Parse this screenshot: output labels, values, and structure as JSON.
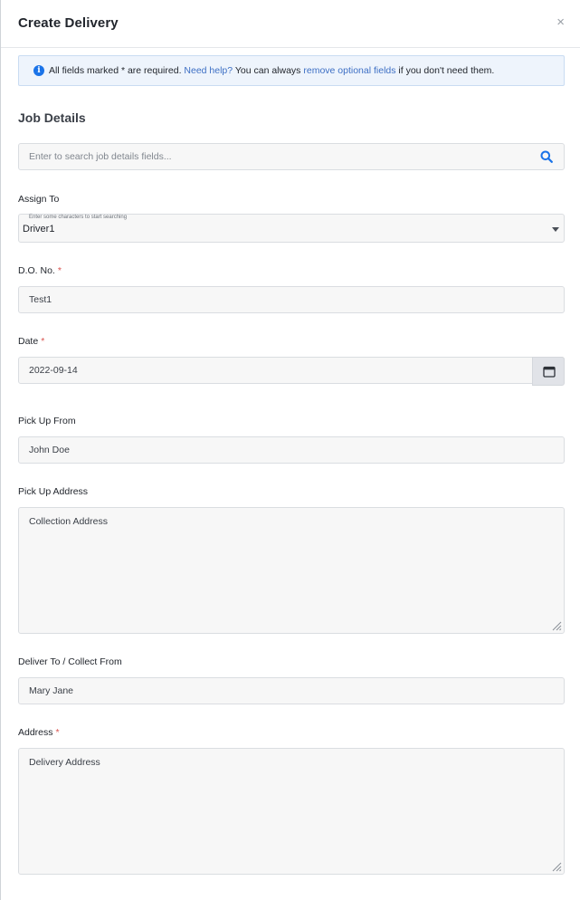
{
  "modal": {
    "title": "Create Delivery",
    "close": "×"
  },
  "notice": {
    "part1": "All fields marked * are required. ",
    "help_link": "Need help?",
    "part2": " You can always ",
    "optional_link": "remove optional fields",
    "part3": " if you don't need them."
  },
  "section": {
    "title": "Job Details"
  },
  "search": {
    "placeholder": "Enter to search job details fields..."
  },
  "fields": {
    "assign_to": {
      "label": "Assign To",
      "hint": "Enter some characters to start searching",
      "value": "Driver1"
    },
    "do_no": {
      "label": "D.O. No.",
      "required": "*",
      "value": "Test1"
    },
    "date": {
      "label": "Date",
      "required": "*",
      "value": "2022-09-14"
    },
    "pick_up_from": {
      "label": "Pick Up From",
      "value": "John Doe"
    },
    "pick_up_address": {
      "label": "Pick Up Address",
      "value": "Collection Address"
    },
    "deliver_to": {
      "label": "Deliver To / Collect From",
      "value": "Mary Jane"
    },
    "address": {
      "label": "Address",
      "required": "*",
      "value": "Delivery Address"
    }
  },
  "icons": {
    "info": "info-icon",
    "search": "search-icon",
    "calendar": "calendar-icon",
    "caret": "caret-down-icon",
    "resize": "resize-handle-icon"
  },
  "colors": {
    "accent": "#1a73e8",
    "link": "#3d6fc4",
    "required": "#d9534f",
    "notice_bg": "#eef4fc"
  }
}
